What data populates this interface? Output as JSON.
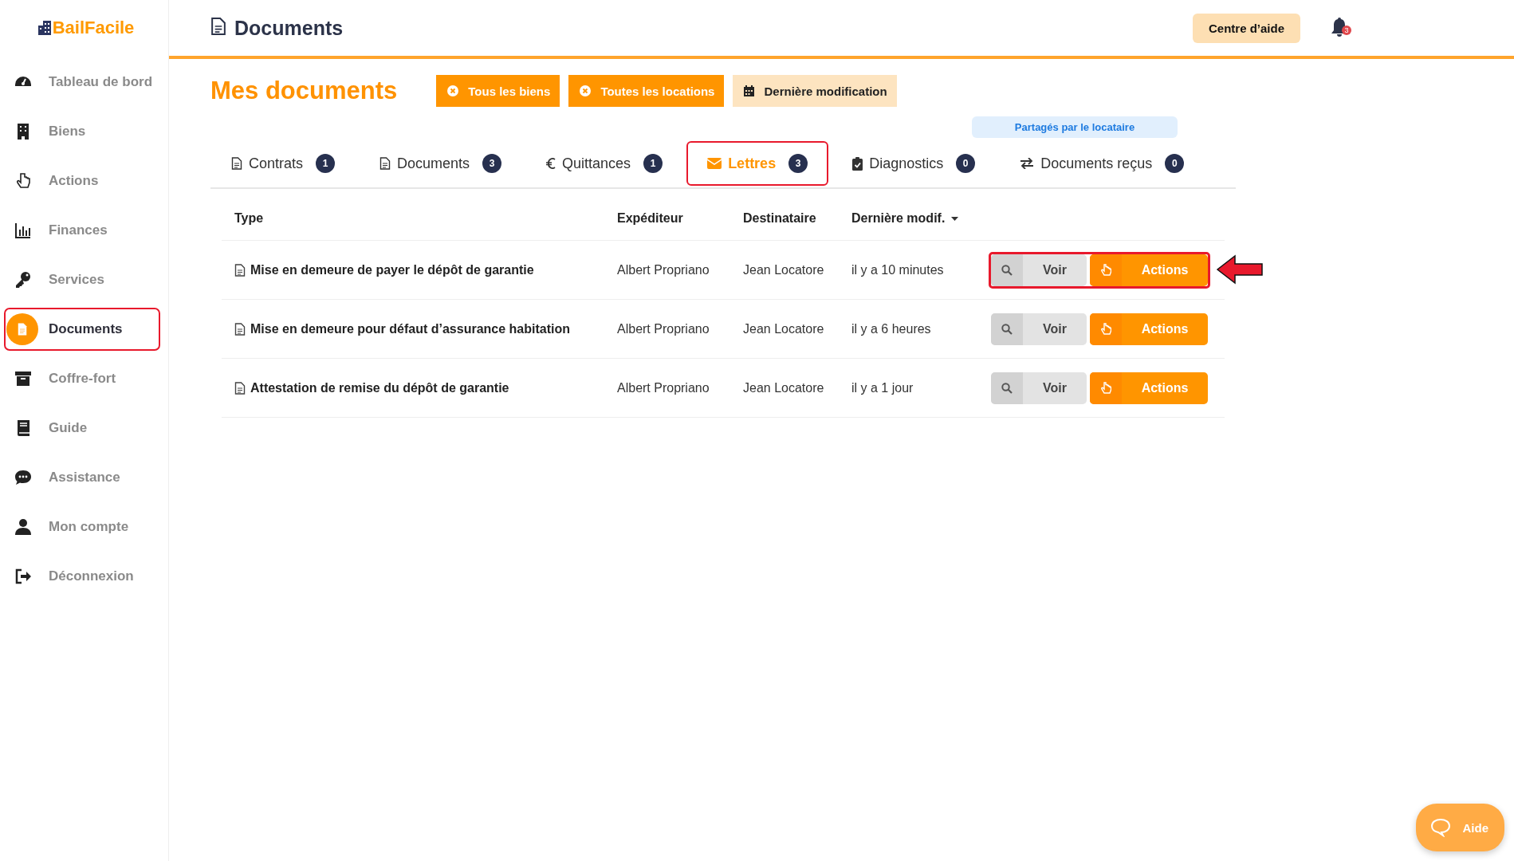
{
  "brand": "BailFacile",
  "sidebar": {
    "items": [
      {
        "label": "Tableau de bord",
        "selected": false,
        "highlighted": false
      },
      {
        "label": "Biens",
        "selected": false,
        "highlighted": false
      },
      {
        "label": "Actions",
        "selected": false,
        "highlighted": false
      },
      {
        "label": "Finances",
        "selected": false,
        "highlighted": false
      },
      {
        "label": "Services",
        "selected": false,
        "highlighted": false
      },
      {
        "label": "Documents",
        "selected": true,
        "highlighted": true
      },
      {
        "label": "Coffre-fort",
        "selected": false,
        "highlighted": false
      },
      {
        "label": "Guide",
        "selected": false,
        "highlighted": false
      },
      {
        "label": "Assistance",
        "selected": false,
        "highlighted": false
      },
      {
        "label": "Mon compte",
        "selected": false,
        "highlighted": false
      },
      {
        "label": "Déconnexion",
        "selected": false,
        "highlighted": false
      }
    ]
  },
  "header": {
    "title": "Documents",
    "help_button": "Centre d’aide",
    "notification_count": "3"
  },
  "page_title": "Mes documents",
  "filters": [
    {
      "label": "Tous les biens",
      "kind": "clear"
    },
    {
      "label": "Toutes les locations",
      "kind": "clear"
    },
    {
      "label": "Dernière modification",
      "kind": "date"
    }
  ],
  "shared_label": "Partagés par le locataire",
  "tabs": [
    {
      "label": "Contrats",
      "count": "1",
      "selected": false,
      "highlighted": false
    },
    {
      "label": "Documents",
      "count": "3",
      "selected": false,
      "highlighted": false
    },
    {
      "label": "Quittances",
      "count": "1",
      "selected": false,
      "highlighted": false
    },
    {
      "label": "Lettres",
      "count": "3",
      "selected": true,
      "highlighted": true
    },
    {
      "label": "Diagnostics",
      "count": "0",
      "selected": false,
      "highlighted": false
    },
    {
      "label": "Documents reçus",
      "count": "0",
      "selected": false,
      "highlighted": false
    }
  ],
  "table": {
    "columns": [
      {
        "label": "Type",
        "sorted": false
      },
      {
        "label": "Expéditeur",
        "sorted": false
      },
      {
        "label": "Destinataire",
        "sorted": false
      },
      {
        "label": "Dernière modif.",
        "sorted": true
      }
    ],
    "rows": [
      {
        "type": "Mise en demeure de payer le dépôt de garantie",
        "sender": "Albert Propriano",
        "recipient": "Jean Locatore",
        "modified": "il y a 10 minutes",
        "view": "Voir",
        "actions": "Actions",
        "highlighted": true
      },
      {
        "type": "Mise en demeure pour défaut d’assurance habitation",
        "sender": "Albert Propriano",
        "recipient": "Jean Locatore",
        "modified": "il y a 6 heures",
        "view": "Voir",
        "actions": "Actions",
        "highlighted": false
      },
      {
        "type": "Attestation de remise du dépôt de garantie",
        "sender": "Albert Propriano",
        "recipient": "Jean Locatore",
        "modified": "il y a 1 jour",
        "view": "Voir",
        "actions": "Actions",
        "highlighted": false
      }
    ]
  },
  "help_fab": "Aide"
}
